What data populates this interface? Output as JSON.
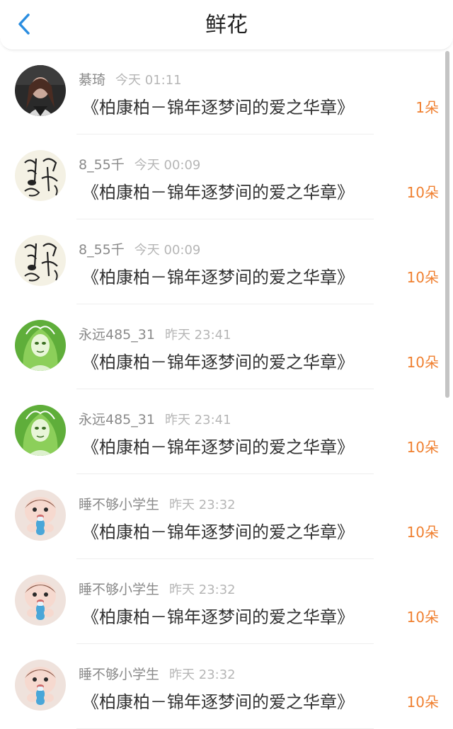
{
  "header": {
    "title": "鲜花",
    "back_icon": "chevron-left-icon",
    "accent": "#2a8de0"
  },
  "colors": {
    "count": "#f08030",
    "name": "#8a8a8a",
    "time": "#b6b6b6",
    "book": "#333333"
  },
  "items": [
    {
      "name": "綦琦",
      "time": "今天 01:11",
      "book": "《柏康柏－锦年逐梦间的爱之华章》",
      "count": "1朵",
      "avatar": "dark-portrait"
    },
    {
      "name": "8_55千",
      "time": "今天 00:09",
      "book": "《柏康柏－锦年逐梦间的爱之华章》",
      "count": "10朵",
      "avatar": "sketch-face"
    },
    {
      "name": "8_55千",
      "time": "今天 00:09",
      "book": "《柏康柏－锦年逐梦间的爱之华章》",
      "count": "10朵",
      "avatar": "sketch-face"
    },
    {
      "name": "永远485_31",
      "time": "昨天 23:41",
      "book": "《柏康柏－锦年逐梦间的爱之华章》",
      "count": "10朵",
      "avatar": "green-girl"
    },
    {
      "name": "永远485_31",
      "time": "昨天 23:41",
      "book": "《柏康柏－锦年逐梦间的爱之华章》",
      "count": "10朵",
      "avatar": "green-girl"
    },
    {
      "name": "睡不够小学生",
      "time": "昨天 23:32",
      "book": "《柏康柏－锦年逐梦间的爱之华章》",
      "count": "10朵",
      "avatar": "baby-bottle"
    },
    {
      "name": "睡不够小学生",
      "time": "昨天 23:32",
      "book": "《柏康柏－锦年逐梦间的爱之华章》",
      "count": "10朵",
      "avatar": "baby-bottle"
    },
    {
      "name": "睡不够小学生",
      "time": "昨天 23:32",
      "book": "《柏康柏－锦年逐梦间的爱之华章》",
      "count": "10朵",
      "avatar": "baby-bottle"
    }
  ]
}
